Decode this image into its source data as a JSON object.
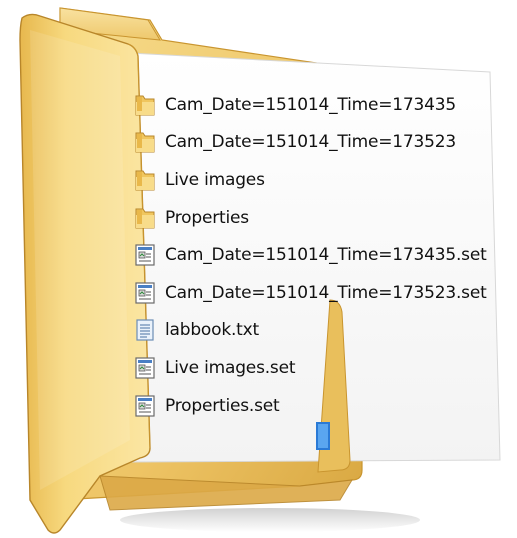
{
  "files": [
    {
      "name": "Cam_Date=151014_Time=173435",
      "icon": "folder-icon"
    },
    {
      "name": "Cam_Date=151014_Time=173523",
      "icon": "folder-icon"
    },
    {
      "name": "Live images",
      "icon": "folder-icon"
    },
    {
      "name": "Properties",
      "icon": "folder-icon"
    },
    {
      "name": "Cam_Date=151014_Time=173435.set",
      "icon": "settings-file-icon"
    },
    {
      "name": "Cam_Date=151014_Time=173523.set",
      "icon": "settings-file-icon"
    },
    {
      "name": "labbook.txt",
      "icon": "text-file-icon"
    },
    {
      "name": "Live images.set",
      "icon": "settings-file-icon"
    },
    {
      "name": "Properties.set",
      "icon": "settings-file-icon"
    }
  ],
  "colors": {
    "folder_light": "#fbe7a6",
    "folder_mid": "#f2cd6e",
    "folder_dark": "#d9a63a",
    "folder_edge": "#b8862a",
    "text": "#111111"
  }
}
